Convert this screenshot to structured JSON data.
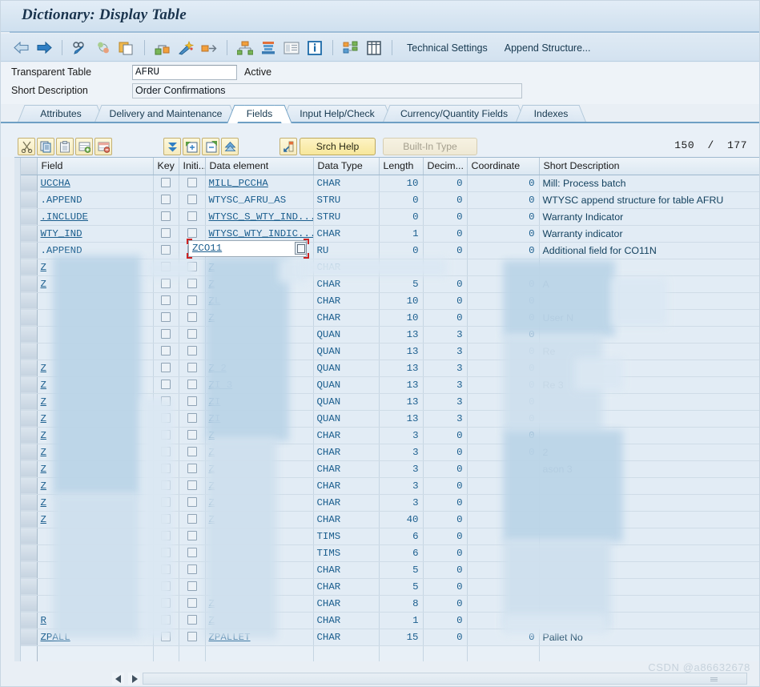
{
  "window": {
    "title": "Dictionary: Display Table"
  },
  "toolbar": {
    "icons": [
      {
        "name": "back-arrow-icon",
        "glyph": "⇦"
      },
      {
        "name": "forward-arrow-icon",
        "glyph": "⇨"
      },
      {
        "name": "display-change-icon",
        "glyph": "✎"
      },
      {
        "name": "refresh-icon",
        "glyph": "↻"
      },
      {
        "name": "copy-object-icon",
        "glyph": "⧉"
      },
      {
        "name": "where-used-list-icon",
        "glyph": "⊞"
      },
      {
        "name": "activate-icon",
        "glyph": "✨"
      },
      {
        "name": "expand-icon",
        "glyph": "⇲"
      },
      {
        "name": "hierarchy-icon",
        "glyph": "⛓"
      },
      {
        "name": "stack-icon",
        "glyph": "☰"
      },
      {
        "name": "documentation-icon",
        "glyph": "☷"
      },
      {
        "name": "info-icon",
        "glyph": "i"
      },
      {
        "name": "structure-display-icon",
        "glyph": "▦"
      },
      {
        "name": "table-contents-icon",
        "glyph": "☰"
      }
    ],
    "technical_settings_label": "Technical Settings",
    "append_structure_label": "Append Structure..."
  },
  "header": {
    "table_type_label": "Transparent Table",
    "table_name": "AFRU",
    "status": "Active",
    "short_description_label": "Short Description",
    "short_description_value": "Order Confirmations"
  },
  "tabs": [
    {
      "label": "Attributes",
      "active": false
    },
    {
      "label": "Delivery and Maintenance",
      "active": false
    },
    {
      "label": "Fields",
      "active": true
    },
    {
      "label": "Input Help/Check",
      "active": false
    },
    {
      "label": "Currency/Quantity Fields",
      "active": false
    },
    {
      "label": "Indexes",
      "active": false
    }
  ],
  "subtoolbar": {
    "buttons": [
      {
        "name": "cut-button",
        "glyph": "✂"
      },
      {
        "name": "copy-button",
        "glyph": "⎘"
      },
      {
        "name": "paste-button",
        "glyph": "⎗"
      },
      {
        "name": "insert-row-button",
        "glyph": "⊞"
      },
      {
        "name": "delete-row-button",
        "glyph": "⊟"
      },
      {
        "name": "scroll-bottom-button",
        "glyph": "▼"
      },
      {
        "name": "new-rows-button",
        "glyph": "⊞"
      },
      {
        "name": "predefined-type-button",
        "glyph": "⊟"
      },
      {
        "name": "move-up-button",
        "glyph": "▲"
      }
    ],
    "data_element_button_name": "data-element-navigate-icon",
    "srch_help_label": "Srch Help",
    "built_in_type_label": "Built-In Type",
    "counter_current": "150",
    "counter_separator": "/",
    "counter_total": "177"
  },
  "grid": {
    "columns": [
      {
        "key": "field",
        "label": "Field"
      },
      {
        "key": "key",
        "label": "Key"
      },
      {
        "key": "initial",
        "label": "Initi..."
      },
      {
        "key": "dataelem",
        "label": "Data element"
      },
      {
        "key": "datatype",
        "label": "Data Type"
      },
      {
        "key": "length",
        "label": "Length"
      },
      {
        "key": "decimals",
        "label": "Decim..."
      },
      {
        "key": "coord",
        "label": "Coordinate"
      },
      {
        "key": "shortdesc",
        "label": "Short Description"
      }
    ],
    "rows": [
      {
        "field": "UCCHA",
        "key": false,
        "initial": false,
        "dataelem": "MILL_PCCHA",
        "datatype": "CHAR",
        "length": "10",
        "decimals": "0",
        "coord": "0",
        "shortdesc": "Mill: Process batch",
        "link": true,
        "redacted": false
      },
      {
        "field": ".APPEND",
        "key": false,
        "initial": false,
        "dataelem": "WTYSC_AFRU_AS",
        "datatype": "STRU",
        "length": "0",
        "decimals": "0",
        "coord": "0",
        "shortdesc": "WTYSC append structure for table AFRU",
        "link": false,
        "redacted": false
      },
      {
        "field": ".INCLUDE",
        "key": false,
        "initial": false,
        "dataelem": "WTYSC_S_WTY_IND...",
        "datatype": "STRU",
        "length": "0",
        "decimals": "0",
        "coord": "0",
        "shortdesc": "Warranty Indicator",
        "link": true,
        "redacted": false
      },
      {
        "field": "WTY_IND",
        "key": false,
        "initial": false,
        "dataelem": "WTYSC_WTY_INDIC...",
        "datatype": "CHAR",
        "length": "1",
        "decimals": "0",
        "coord": "0",
        "shortdesc": "Warranty indicator",
        "link": true,
        "redacted": false
      },
      {
        "field": ".APPEND",
        "key": false,
        "initial": false,
        "dataelem": "ZCO11",
        "datatype": "RU",
        "length": "0",
        "decimals": "0",
        "coord": "0",
        "shortdesc": "Additional field for CO11N",
        "link": false,
        "redacted": false,
        "active": true
      },
      {
        "field": "Z",
        "key": false,
        "initial": false,
        "dataelem": "Z",
        "datatype": "CHAR",
        "length": "",
        "decimals": "",
        "coord": "",
        "shortdesc": "",
        "link": true,
        "redacted": true
      },
      {
        "field": "Z",
        "key": false,
        "initial": false,
        "dataelem": "Z",
        "datatype": "CHAR",
        "length": "5",
        "decimals": "0",
        "coord": "0",
        "shortdesc": "A",
        "link": true,
        "redacted": true
      },
      {
        "field": "",
        "key": false,
        "initial": false,
        "dataelem": "ZL",
        "datatype": "CHAR",
        "length": "10",
        "decimals": "0",
        "coord": "0",
        "shortdesc": "",
        "link": true,
        "redacted": true
      },
      {
        "field": "",
        "key": false,
        "initial": false,
        "dataelem": "Z",
        "datatype": "CHAR",
        "length": "10",
        "decimals": "0",
        "coord": "0",
        "shortdesc": "User N",
        "link": true,
        "redacted": true
      },
      {
        "field": "",
        "key": false,
        "initial": false,
        "dataelem": "",
        "datatype": "QUAN",
        "length": "13",
        "decimals": "3",
        "coord": "0",
        "shortdesc": "",
        "link": true,
        "redacted": true
      },
      {
        "field": "",
        "key": false,
        "initial": false,
        "dataelem": "",
        "datatype": "QUAN",
        "length": "13",
        "decimals": "3",
        "coord": "0",
        "shortdesc": "Re",
        "link": true,
        "redacted": true
      },
      {
        "field": "Z",
        "key": false,
        "initial": false,
        "dataelem": "Z      2",
        "datatype": "QUAN",
        "length": "13",
        "decimals": "3",
        "coord": "0",
        "shortdesc": "",
        "link": true,
        "redacted": true
      },
      {
        "field": "Z",
        "key": false,
        "initial": false,
        "dataelem": "ZI     3",
        "datatype": "QUAN",
        "length": "13",
        "decimals": "3",
        "coord": "0",
        "shortdesc": "Re        3",
        "link": true,
        "redacted": true
      },
      {
        "field": "Z",
        "key": false,
        "initial": false,
        "dataelem": "ZI",
        "datatype": "QUAN",
        "length": "13",
        "decimals": "3",
        "coord": "0",
        "shortdesc": "",
        "link": true,
        "redacted": true
      },
      {
        "field": "Z",
        "key": false,
        "initial": false,
        "dataelem": "ZI",
        "datatype": "QUAN",
        "length": "13",
        "decimals": "3",
        "coord": "0",
        "shortdesc": "",
        "link": true,
        "redacted": true
      },
      {
        "field": "Z",
        "key": false,
        "initial": false,
        "dataelem": "Z",
        "datatype": "CHAR",
        "length": "3",
        "decimals": "0",
        "coord": "0",
        "shortdesc": "",
        "link": true,
        "redacted": true
      },
      {
        "field": "Z",
        "key": false,
        "initial": false,
        "dataelem": "Z",
        "datatype": "CHAR",
        "length": "3",
        "decimals": "0",
        "coord": "0",
        "shortdesc": "          2",
        "link": true,
        "redacted": true
      },
      {
        "field": "Z",
        "key": false,
        "initial": false,
        "dataelem": "Z",
        "datatype": "CHAR",
        "length": "3",
        "decimals": "0",
        "coord": "",
        "shortdesc": "ason 3",
        "link": true,
        "redacted": true
      },
      {
        "field": "Z",
        "key": false,
        "initial": false,
        "dataelem": "Z",
        "datatype": "CHAR",
        "length": "3",
        "decimals": "0",
        "coord": "",
        "shortdesc": "",
        "link": true,
        "redacted": true
      },
      {
        "field": "Z",
        "key": false,
        "initial": false,
        "dataelem": "Z",
        "datatype": "CHAR",
        "length": "3",
        "decimals": "0",
        "coord": "",
        "shortdesc": "",
        "link": true,
        "redacted": true
      },
      {
        "field": "Z",
        "key": false,
        "initial": false,
        "dataelem": "Z",
        "datatype": "CHAR",
        "length": "40",
        "decimals": "0",
        "coord": "",
        "shortdesc": "",
        "link": true,
        "redacted": true
      },
      {
        "field": "",
        "key": false,
        "initial": false,
        "dataelem": "",
        "datatype": "TIMS",
        "length": "6",
        "decimals": "0",
        "coord": "",
        "shortdesc": "",
        "link": true,
        "redacted": true
      },
      {
        "field": "",
        "key": false,
        "initial": false,
        "dataelem": "",
        "datatype": "TIMS",
        "length": "6",
        "decimals": "0",
        "coord": "",
        "shortdesc": "",
        "link": true,
        "redacted": true
      },
      {
        "field": "",
        "key": false,
        "initial": false,
        "dataelem": "",
        "datatype": "CHAR",
        "length": "5",
        "decimals": "0",
        "coord": "",
        "shortdesc": "",
        "link": true,
        "redacted": true
      },
      {
        "field": "",
        "key": false,
        "initial": false,
        "dataelem": "",
        "datatype": "CHAR",
        "length": "5",
        "decimals": "0",
        "coord": "",
        "shortdesc": "",
        "link": true,
        "redacted": true
      },
      {
        "field": "",
        "key": false,
        "initial": false,
        "dataelem": "Z",
        "datatype": "CHAR",
        "length": "8",
        "decimals": "0",
        "coord": "",
        "shortdesc": "",
        "link": true,
        "redacted": true
      },
      {
        "field": "R",
        "key": false,
        "initial": false,
        "dataelem": "Z",
        "datatype": "CHAR",
        "length": "1",
        "decimals": "0",
        "coord": "",
        "shortdesc": "",
        "link": true,
        "redacted": true
      },
      {
        "field": "ZPALL",
        "key": false,
        "initial": false,
        "dataelem": "ZPALLET",
        "datatype": "CHAR",
        "length": "15",
        "decimals": "0",
        "coord": "0",
        "shortdesc": "Pallet No",
        "link": true,
        "redacted": false
      },
      {
        "field": "",
        "key": null,
        "initial": null,
        "dataelem": "",
        "datatype": "",
        "length": "",
        "decimals": "",
        "coord": "",
        "shortdesc": "",
        "link": false,
        "blank": true
      },
      {
        "field": "",
        "key": null,
        "initial": null,
        "dataelem": "",
        "datatype": "",
        "length": "",
        "decimals": "",
        "coord": "",
        "shortdesc": "",
        "link": false,
        "blank": true
      }
    ]
  },
  "scrollbar": {
    "left_arrow": "◀",
    "right_arrow": "▶"
  },
  "watermark": "CSDN @a86632678",
  "colors": {
    "accent": "#1b5e8e",
    "title": "#19334d",
    "grid_row": "#e2ecf5",
    "button_yellow": "#f7e79b",
    "selection_red": "#cc2222"
  }
}
